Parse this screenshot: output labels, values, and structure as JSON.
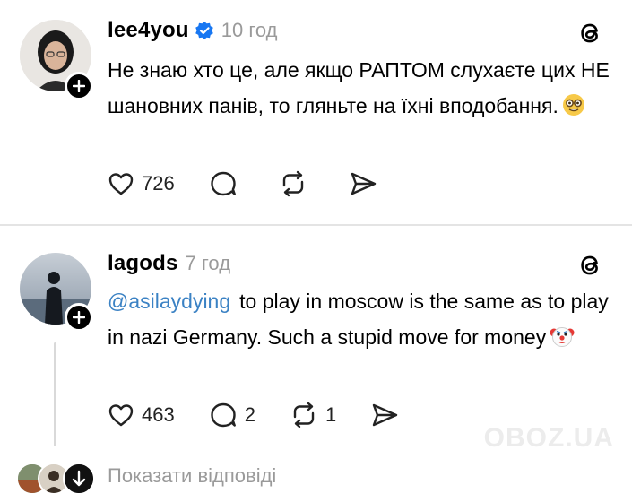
{
  "posts": [
    {
      "username": "lee4you",
      "verified": true,
      "time": "10 год",
      "text": "Не знаю хто це, але якщо РАПТОМ слухаєте цих НЕ шановних панів, то гляньте на їхні вподобання.",
      "emoji": "nerd-face",
      "likes": "726",
      "comments": "",
      "reposts": ""
    },
    {
      "username": "lagods",
      "verified": false,
      "time": "7 год",
      "mention": "@asilaydying",
      "text": "to play in  moscow is the same as to play in nazi Germany. Such a stupid move for money",
      "emoji": "clown-face",
      "likes": "463",
      "comments": "2",
      "reposts": "1"
    }
  ],
  "show_replies_label": "Показати відповіді",
  "watermark": "OBOZ.UA",
  "colors": {
    "accent_blue": "#3b82c4",
    "muted_gray": "#9a9a9a",
    "verified_blue": "#1877f2"
  }
}
